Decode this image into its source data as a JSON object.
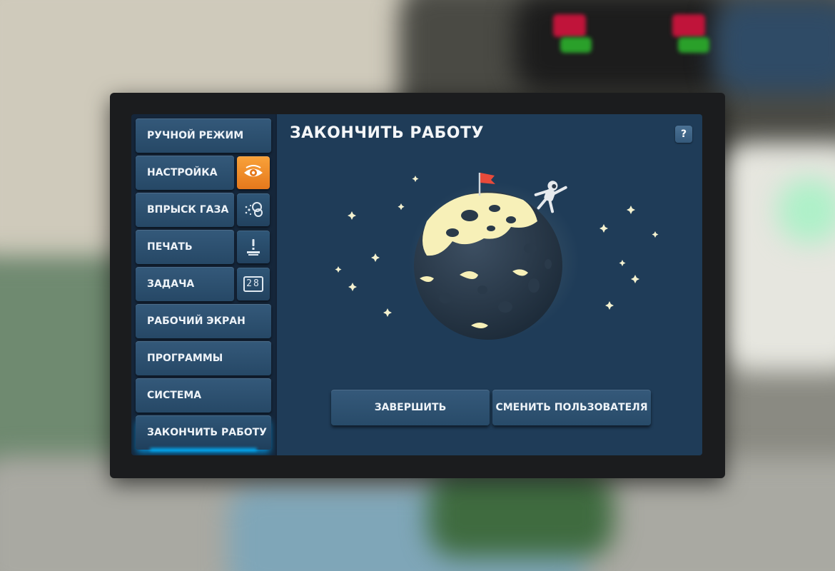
{
  "sidebar": {
    "items": [
      {
        "label": "РУЧНОЙ РЕЖИМ"
      },
      {
        "label": "НАСТРОЙКА",
        "icon": "eye-icon"
      },
      {
        "label": "ВПРЫСК ГАЗА",
        "icon": "gas-injection-icon"
      },
      {
        "label": "ПЕЧАТЬ",
        "icon": "print-icon"
      },
      {
        "label": "ЗАДАЧА",
        "icon": "task-counter-icon",
        "icon_text": "28"
      },
      {
        "label": "РАБОЧИЙ ЭКРАН"
      },
      {
        "label": "ПРОГРАММЫ"
      },
      {
        "label": "СИСТЕМА"
      },
      {
        "label": "ЗАКОНЧИТЬ РАБОТУ",
        "active": true
      }
    ]
  },
  "main": {
    "title": "ЗАКОНЧИТЬ РАБОТУ",
    "help_label": "?",
    "buttons": {
      "finish": "ЗАВЕРШИТЬ",
      "switch_user": "СМЕНИТЬ ПОЛЬЗОВАТЕЛЯ"
    }
  },
  "colors": {
    "accent": "#00b4ff",
    "orange_icon": "#f39227",
    "panel": "#1f3c58",
    "sidebar": "#15263a"
  }
}
